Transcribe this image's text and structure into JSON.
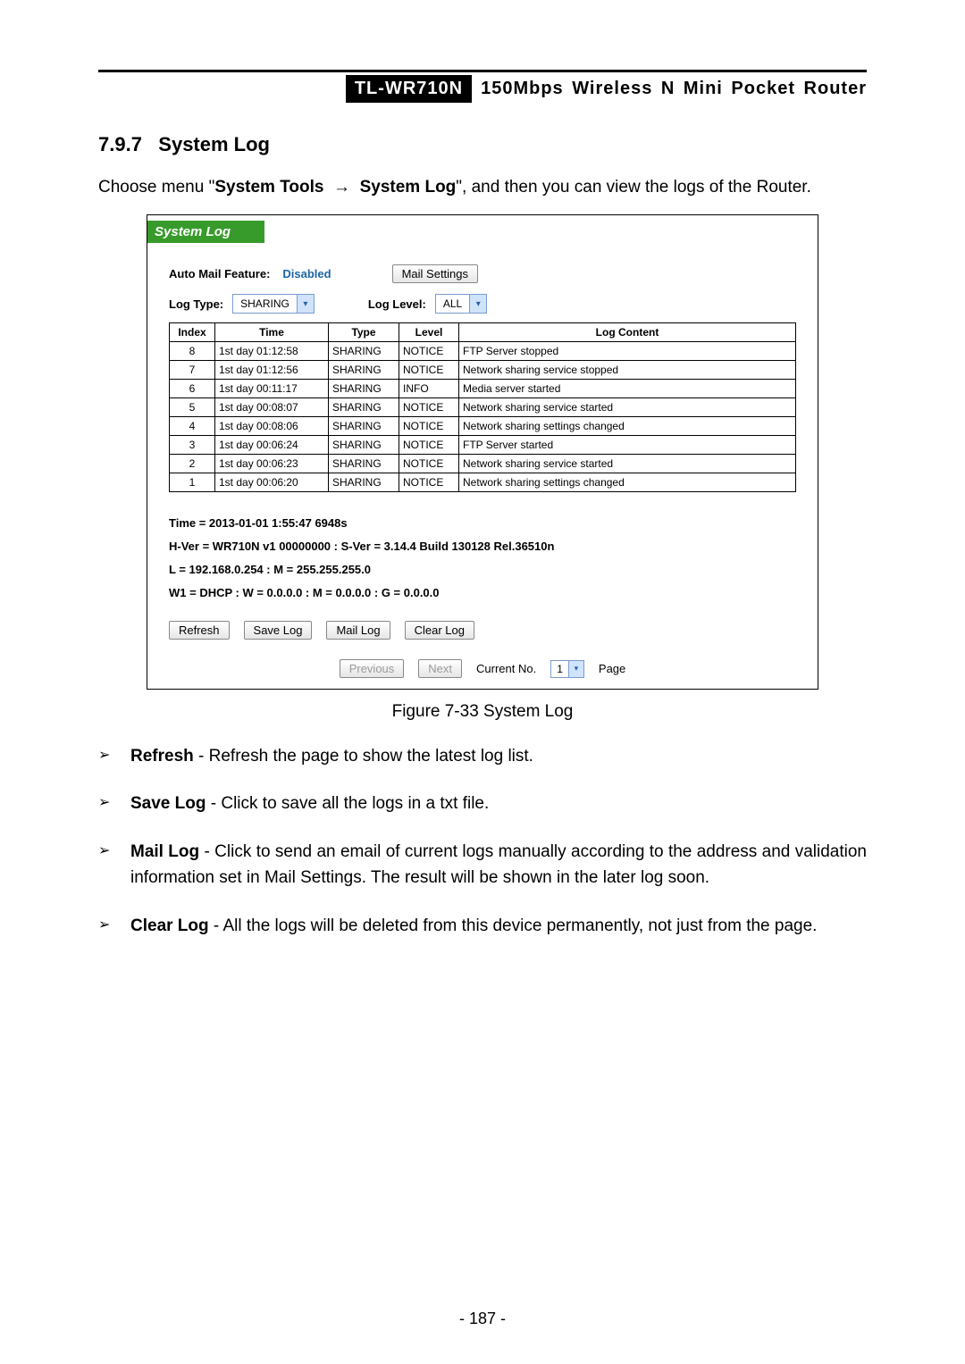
{
  "header": {
    "model": "TL-WR710N",
    "desc": "150Mbps Wireless N Mini Pocket Router"
  },
  "section": {
    "number": "7.9.7",
    "title": "System Log"
  },
  "intro": {
    "pre": "Choose menu \"",
    "path1": "System Tools",
    "arrow": "→",
    "path2": "System Log",
    "post": "\", and then you can view the logs of the Router."
  },
  "figure": {
    "banner": "System Log",
    "autoMailLabel": "Auto Mail Feature:",
    "autoMailStatus": "Disabled",
    "mailSettingsBtn": "Mail Settings",
    "logTypeLabel": "Log Type:",
    "logTypeValue": "SHARING",
    "logLevelLabel": "Log Level:",
    "logLevelValue": "ALL",
    "cols": {
      "index": "Index",
      "time": "Time",
      "type": "Type",
      "level": "Level",
      "content": "Log Content"
    },
    "rows": [
      {
        "i": "8",
        "t": "1st day 01:12:58",
        "ty": "SHARING",
        "lv": "NOTICE",
        "c": "FTP Server stopped"
      },
      {
        "i": "7",
        "t": "1st day 01:12:56",
        "ty": "SHARING",
        "lv": "NOTICE",
        "c": "Network sharing service stopped"
      },
      {
        "i": "6",
        "t": "1st day 00:11:17",
        "ty": "SHARING",
        "lv": "INFO",
        "c": "Media server started"
      },
      {
        "i": "5",
        "t": "1st day 00:08:07",
        "ty": "SHARING",
        "lv": "NOTICE",
        "c": "Network sharing service started"
      },
      {
        "i": "4",
        "t": "1st day 00:08:06",
        "ty": "SHARING",
        "lv": "NOTICE",
        "c": "Network sharing settings changed"
      },
      {
        "i": "3",
        "t": "1st day 00:06:24",
        "ty": "SHARING",
        "lv": "NOTICE",
        "c": "FTP Server started"
      },
      {
        "i": "2",
        "t": "1st day 00:06:23",
        "ty": "SHARING",
        "lv": "NOTICE",
        "c": "Network sharing service started"
      },
      {
        "i": "1",
        "t": "1st day 00:06:20",
        "ty": "SHARING",
        "lv": "NOTICE",
        "c": "Network sharing settings changed"
      }
    ],
    "status": {
      "l1": "Time = 2013-01-01 1:55:47 6948s",
      "l2": "H-Ver = WR710N v1 00000000 : S-Ver = 3.14.4 Build 130128 Rel.36510n",
      "l3": "L = 192.168.0.254 : M = 255.255.255.0",
      "l4": "W1 = DHCP : W = 0.0.0.0 : M = 0.0.0.0 : G = 0.0.0.0"
    },
    "buttons": {
      "refresh": "Refresh",
      "save": "Save Log",
      "mail": "Mail Log",
      "clear": "Clear Log"
    },
    "pager": {
      "prev": "Previous",
      "next": "Next",
      "currentLabel": "Current No.",
      "currentValue": "1",
      "pageLabel": "Page"
    },
    "caption": "Figure 7-33    System Log"
  },
  "bullets": [
    {
      "term": "Refresh",
      "desc": " - Refresh the page to show the latest log list."
    },
    {
      "term": "Save Log",
      "desc": " - Click to save all the logs in a txt file."
    },
    {
      "term": "Mail Log",
      "desc": " - Click to send an email of current logs manually according to the address and validation information set in Mail Settings. The result will be shown in the later log soon."
    },
    {
      "term": "Clear Log",
      "desc": " - All the logs will be deleted from this device permanently, not just from the page."
    }
  ],
  "pageNumber": "- 187 -"
}
